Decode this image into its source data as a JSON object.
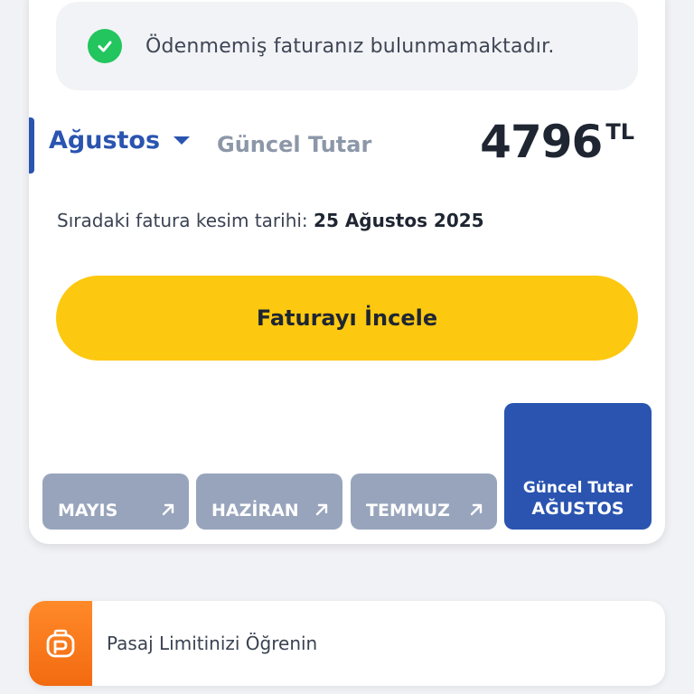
{
  "notice": {
    "text": "Ödenmemiş faturanız bulunmamaktadır.",
    "icon": "check-circle-icon"
  },
  "billing": {
    "selected_month": "Ağustos",
    "current_label": "Güncel Tutar",
    "amount": "4796",
    "currency": "TL",
    "cutoff_prefix": "Sıradaki fatura kesim tarihi: ",
    "cutoff_date": "25 Ağustos 2025",
    "review_button": "Faturayı İncele"
  },
  "month_tabs": [
    {
      "label": "MAYIS",
      "icon": "arrow-up-right-icon"
    },
    {
      "label": "HAZİRAN",
      "icon": "arrow-up-right-icon"
    },
    {
      "label": "TEMMUZ",
      "icon": "arrow-up-right-icon"
    }
  ],
  "current_tab": {
    "line1": "Güncel Tutar",
    "line2": "AĞUSTOS"
  },
  "pasaj": {
    "text": "Pasaj Limitinizi Öğrenin",
    "icon": "pasaj-logo-icon"
  },
  "colors": {
    "brand_blue": "#2a54b0",
    "brand_yellow": "#fdc810",
    "success_green": "#22c55e",
    "tab_grey": "#97a4bc",
    "pasaj_orange": "#f36a10"
  }
}
